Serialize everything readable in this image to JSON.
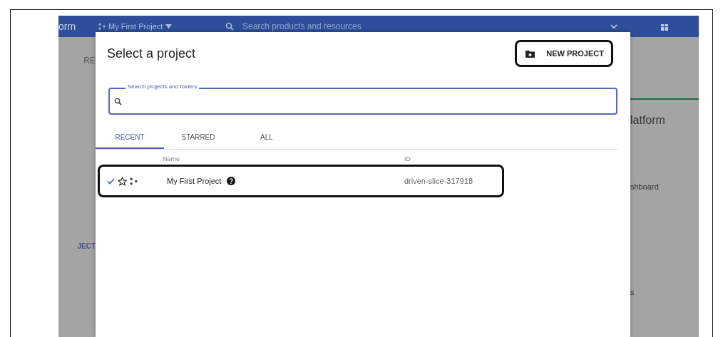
{
  "background": {
    "header": {
      "product": "orm",
      "project": "My First Project",
      "search_placeholder": "Search products and resources"
    },
    "left_texts": [
      "RE",
      "JECT"
    ],
    "right_texts": [
      "latform",
      "shboard",
      "s"
    ]
  },
  "dialog": {
    "title": "Select a project",
    "new_project_button": "NEW PROJECT",
    "search": {
      "label": "Search projects and folders"
    },
    "tabs": [
      {
        "label": "RECENT",
        "selected": true
      },
      {
        "label": "STARRED",
        "selected": false
      },
      {
        "label": "ALL",
        "selected": false
      }
    ],
    "table": {
      "columns": [
        "Name",
        "ID"
      ],
      "rows": [
        {
          "checked": true,
          "starred": false,
          "name": "My First Project",
          "id": "driven-slice-317918"
        }
      ]
    }
  }
}
